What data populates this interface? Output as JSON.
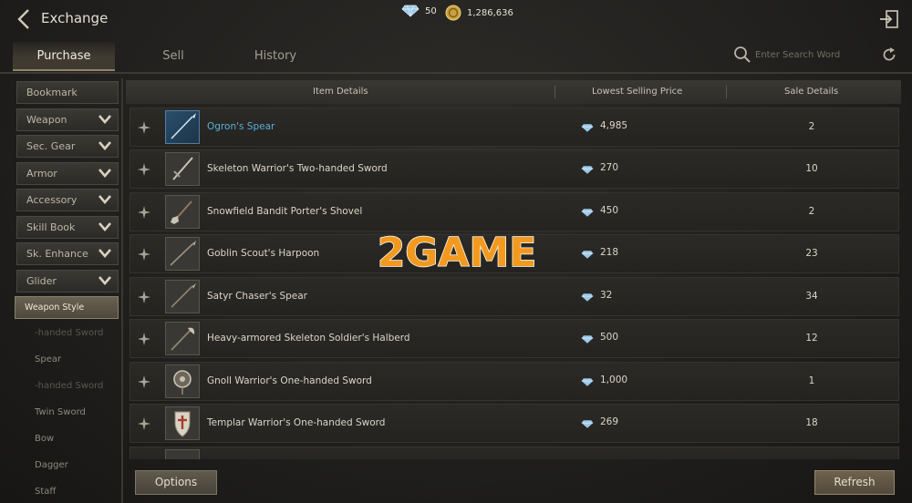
{
  "header": {
    "title": "Exchange",
    "diamonds": "50",
    "gold": "1,286,636"
  },
  "tabs": [
    {
      "label": "Purchase"
    },
    {
      "label": "Sell"
    },
    {
      "label": "History"
    }
  ],
  "search": {
    "placeholder": "Enter Search Word"
  },
  "sidebar": {
    "categories": [
      {
        "label": "Bookmark"
      },
      {
        "label": "Weapon"
      },
      {
        "label": "Sec. Gear"
      },
      {
        "label": "Armor"
      },
      {
        "label": "Accessory"
      },
      {
        "label": "Skill Book"
      },
      {
        "label": "Sk. Enhance"
      },
      {
        "label": "Glider"
      },
      {
        "label": "Weapon Style"
      }
    ],
    "subcategories": [
      {
        "label": "-handed Sword"
      },
      {
        "label": "Spear"
      },
      {
        "label": "-handed Sword"
      },
      {
        "label": "Twin Sword"
      },
      {
        "label": "Bow"
      },
      {
        "label": "Dagger"
      },
      {
        "label": "Staff"
      }
    ]
  },
  "table": {
    "columns": {
      "item": "Item Details",
      "price": "Lowest Selling Price",
      "sale": "Sale Details"
    },
    "rows": [
      {
        "name": "Ogron's Spear",
        "price": "4,985",
        "count": "2",
        "icon": "spear-icon"
      },
      {
        "name": "Skeleton Warrior's Two-handed Sword",
        "price": "270",
        "count": "10",
        "icon": "sword-icon"
      },
      {
        "name": "Snowfield Bandit Porter's Shovel",
        "price": "450",
        "count": "2",
        "icon": "shovel-icon"
      },
      {
        "name": "Goblin Scout's Harpoon",
        "price": "218",
        "count": "23",
        "icon": "harpoon-icon"
      },
      {
        "name": "Satyr Chaser's Spear",
        "price": "32",
        "count": "34",
        "icon": "spear-icon"
      },
      {
        "name": "Heavy-armored Skeleton Soldier's Halberd",
        "price": "500",
        "count": "12",
        "icon": "halberd-icon"
      },
      {
        "name": "Gnoll Warrior's One-handed Sword",
        "price": "1,000",
        "count": "1",
        "icon": "round-shield-icon"
      },
      {
        "name": "Templar Warrior's One-handed Sword",
        "price": "269",
        "count": "18",
        "icon": "kite-shield-icon"
      }
    ]
  },
  "buttons": {
    "options": "Options",
    "refresh": "Refresh"
  },
  "watermark": "2GAME",
  "colors": {
    "rare_item": "#5aaedc",
    "diamond": "#9ec9e8",
    "gold": "#c9a13c",
    "watermark": "#f29a1f"
  }
}
